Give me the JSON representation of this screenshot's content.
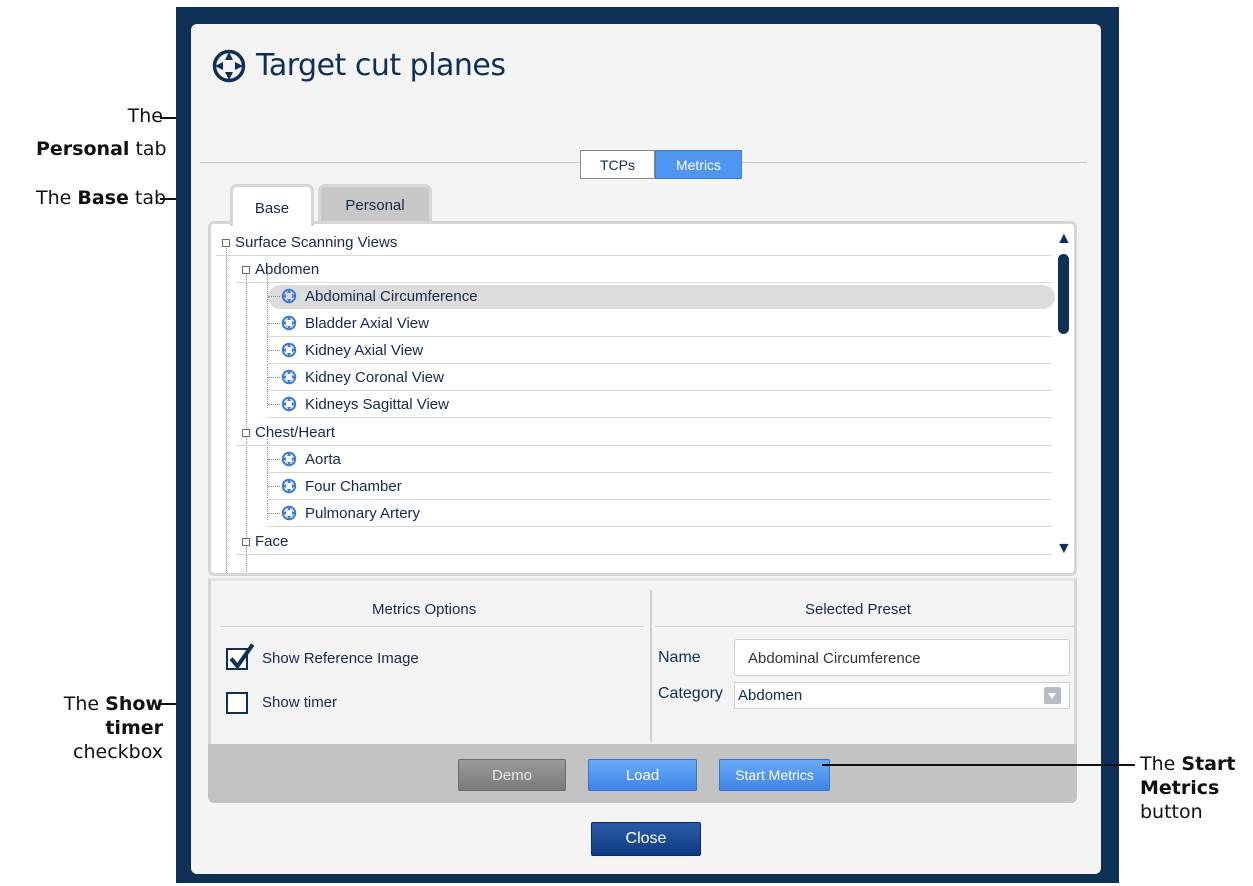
{
  "dialog": {
    "title": "Target cut planes"
  },
  "segments": {
    "tcps": "TCPs",
    "metrics": "Metrics"
  },
  "folder_tabs": {
    "base": "Base",
    "personal": "Personal"
  },
  "tree": {
    "root": "Surface Scanning Views",
    "abdomen": "Abdomen",
    "abdominal_circumference": "Abdominal Circumference",
    "bladder_axial": "Bladder Axial View",
    "kidney_axial": "Kidney Axial View",
    "kidney_coronal": "Kidney Coronal View",
    "kidneys_sagittal": "Kidneys Sagittal View",
    "chest_heart": "Chest/Heart",
    "aorta": "Aorta",
    "four_chamber": "Four Chamber",
    "pulmonary_artery": "Pulmonary Artery",
    "face": "Face",
    "selected_item": "Abdominal Circumference"
  },
  "metrics_options": {
    "heading": "Metrics Options",
    "show_reference_image": "Show Reference Image",
    "show_reference_image_checked": true,
    "show_timer": "Show timer",
    "show_timer_checked": false
  },
  "selected_preset": {
    "heading": "Selected Preset",
    "name_label": "Name",
    "name_value": "Abdominal Circumference",
    "category_label": "Category",
    "category_value": "Abdomen"
  },
  "buttons": {
    "demo": "Demo",
    "load": "Load",
    "start_metrics": "Start Metrics",
    "close": "Close"
  },
  "callouts": {
    "personal_line1": "The",
    "personal_bold": "Personal",
    "personal_after": " tab",
    "base_before": "The ",
    "base_bold": "Base",
    "base_after": " tab",
    "timer_before": "The ",
    "timer_bold1": "Show",
    "timer_bold2": "timer",
    "timer_after": "checkbox",
    "start_before": "The ",
    "start_bold1": "Start",
    "start_bold2": "Metrics",
    "start_after": "button"
  },
  "colors": {
    "frame": "#0e2f56",
    "accent_blue": "#4f95f2",
    "close_button": "#0d3b85",
    "highlight": "#dcdcdc"
  }
}
